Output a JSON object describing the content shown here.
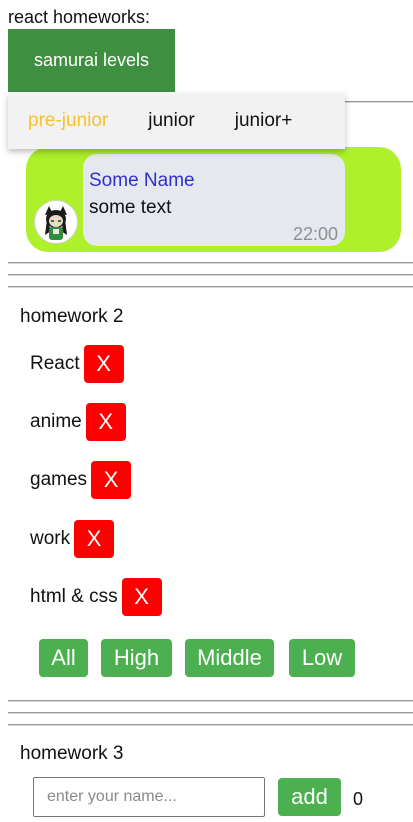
{
  "header": {
    "title": "react homeworks:",
    "levels_button": "samurai levels"
  },
  "levels_menu": {
    "items": [
      {
        "label": "pre-junior",
        "active": true
      },
      {
        "label": "junior",
        "active": false
      },
      {
        "label": "junior+",
        "active": false
      }
    ],
    "active_color": "#f7c12f"
  },
  "message": {
    "name": "Some Name",
    "text": "some text",
    "time": "22:00",
    "avatar_icon": "anime-girl-avatar-icon",
    "background_color": "#aef02a",
    "bubble_color": "#e5e9ef",
    "name_color": "#2f2fd0"
  },
  "homework2": {
    "title": "homework 2",
    "delete_label": "X",
    "affairs": [
      {
        "name": "React"
      },
      {
        "name": "anime"
      },
      {
        "name": "games"
      },
      {
        "name": "work"
      },
      {
        "name": "html & css"
      }
    ],
    "filters": [
      "All",
      "High",
      "Middle",
      "Low"
    ],
    "delete_color": "#ff0000",
    "button_color": "#4caf50"
  },
  "homework3": {
    "title": "homework 3",
    "input_placeholder": "enter your name...",
    "input_value": "",
    "add_label": "add",
    "count": "0"
  }
}
